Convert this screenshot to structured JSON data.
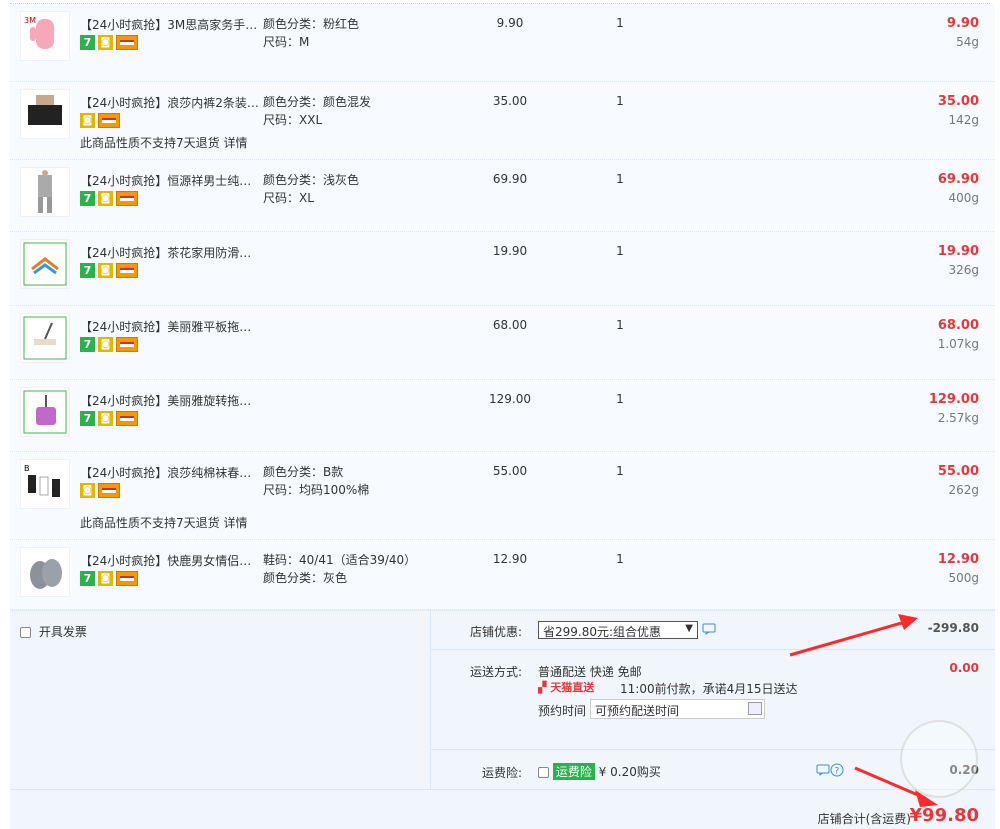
{
  "items": [
    {
      "title": "【24小时疯抢】3M思高家务手…",
      "badges": [
        "7",
        "shield",
        "card"
      ],
      "spec1": "颜色分类：粉红色",
      "spec2": "尺码：M",
      "price": "9.90",
      "qty": "1",
      "subtotal": "9.90",
      "weight": "54g",
      "note": "",
      "thumb": "pink-glove"
    },
    {
      "title": "【24小时疯抢】浪莎内裤2条装…",
      "badges": [
        "shield",
        "card"
      ],
      "spec1": "颜色分类：颜色混发",
      "spec2": "尺码：XXL",
      "price": "35.00",
      "qty": "1",
      "subtotal": "35.00",
      "weight": "142g",
      "note": "此商品性质不支持7天退货 详情",
      "thumb": "underwear"
    },
    {
      "title": "【24小时疯抢】恒源祥男士纯…",
      "badges": [
        "7",
        "shield",
        "card"
      ],
      "spec1": "颜色分类：浅灰色",
      "spec2": "尺码：XL",
      "price": "69.90",
      "qty": "1",
      "subtotal": "69.90",
      "weight": "400g",
      "note": "",
      "thumb": "thermal"
    },
    {
      "title": "【24小时疯抢】茶花家用防滑…",
      "badges": [
        "7",
        "shield",
        "card"
      ],
      "spec1": "",
      "spec2": "",
      "price": "19.90",
      "qty": "1",
      "subtotal": "19.90",
      "weight": "326g",
      "note": "",
      "thumb": "hanger"
    },
    {
      "title": "【24小时疯抢】美丽雅平板拖…",
      "badges": [
        "7",
        "shield",
        "card"
      ],
      "spec1": "",
      "spec2": "",
      "price": "68.00",
      "qty": "1",
      "subtotal": "68.00",
      "weight": "1.07kg",
      "note": "",
      "thumb": "mop"
    },
    {
      "title": "【24小时疯抢】美丽雅旋转拖…",
      "badges": [
        "7",
        "shield",
        "card"
      ],
      "spec1": "",
      "spec2": "",
      "price": "129.00",
      "qty": "1",
      "subtotal": "129.00",
      "weight": "2.57kg",
      "note": "",
      "thumb": "spin-mop"
    },
    {
      "title": "【24小时疯抢】浪莎纯棉袜春…",
      "badges": [
        "shield",
        "card"
      ],
      "spec1": "颜色分类：B款",
      "spec2": "尺码：均码100%棉",
      "price": "55.00",
      "qty": "1",
      "subtotal": "55.00",
      "weight": "262g",
      "note": "此商品性质不支持7天退货 详情",
      "thumb": "socks"
    },
    {
      "title": "【24小时疯抢】快鹿男女情侣…",
      "badges": [
        "7",
        "shield",
        "card"
      ],
      "spec1": "鞋码：40/41（适合39/40）",
      "spec2": "颜色分类：灰色",
      "price": "12.90",
      "qty": "1",
      "subtotal": "12.90",
      "weight": "500g",
      "note": "",
      "thumb": "slipper"
    }
  ],
  "invoice": {
    "label": "开具发票"
  },
  "discount": {
    "label": "店铺优惠:",
    "selected": "省299.80元:组合优惠",
    "amount": "-299.80"
  },
  "shipping": {
    "label": "运送方式:",
    "method": "普通配送 快递 免邮",
    "tmall": "天猫直送",
    "promise": "11:00前付款，承诺4月15日送达",
    "reserve_label": "预约时间",
    "reserve_placeholder": "可预约配送时间",
    "amount": "0.00"
  },
  "insurance": {
    "label": "运费险:",
    "tag": "运费险",
    "price": "¥ 0.20购买",
    "amount": "0.20"
  },
  "total": {
    "label": "店铺合计(含运费)",
    "amount": "¥99.80"
  },
  "colors": {
    "accent": "#e4393c",
    "bg": "#f7fbff",
    "badge_green": "#2bb24c"
  }
}
